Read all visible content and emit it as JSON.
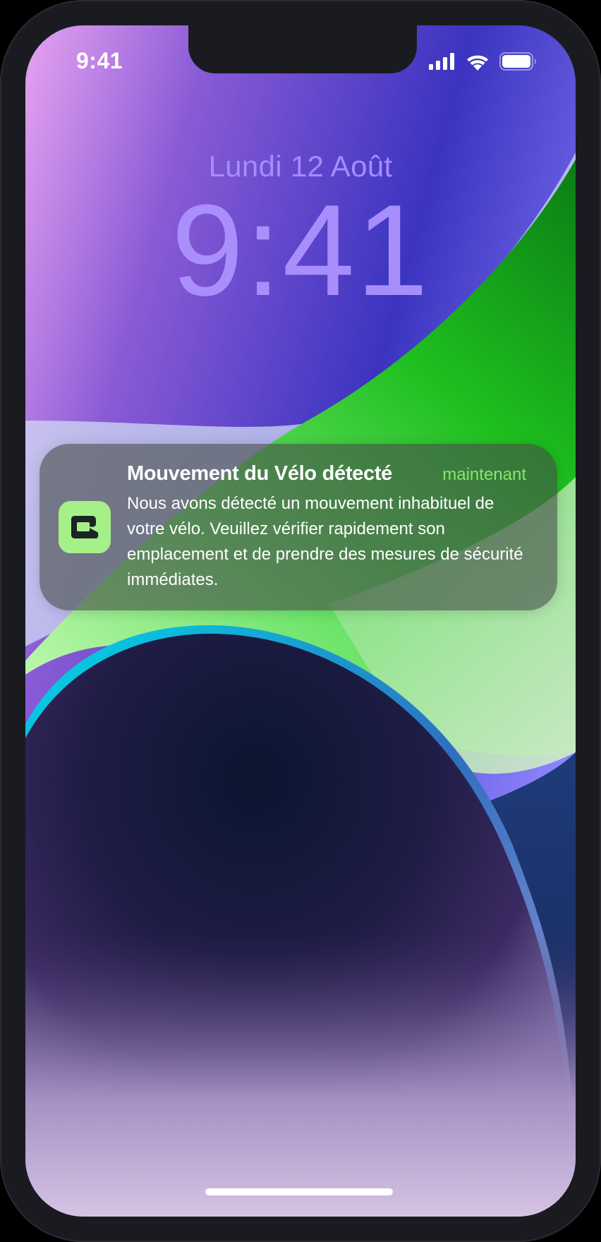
{
  "status_bar": {
    "time": "9:41",
    "icons": [
      "cellular-signal-icon",
      "wifi-icon",
      "battery-icon"
    ]
  },
  "lock_screen": {
    "date": "Lundi 12 Août",
    "time": "9:41"
  },
  "notification": {
    "app_icon": "bike-lock-app-icon",
    "title": "Mouvement du Vélo détecté",
    "timestamp": "maintenant",
    "body": "Nous avons détecté un mouvement inhabituel de votre vélo. Veuillez vérifier rapidement son emplacement et de prendre des mesures de sécurité immédiates."
  },
  "colors": {
    "lock_text": "#ad93ff",
    "accent_green": "#86e86b",
    "app_icon_bg": "#a6f089"
  }
}
